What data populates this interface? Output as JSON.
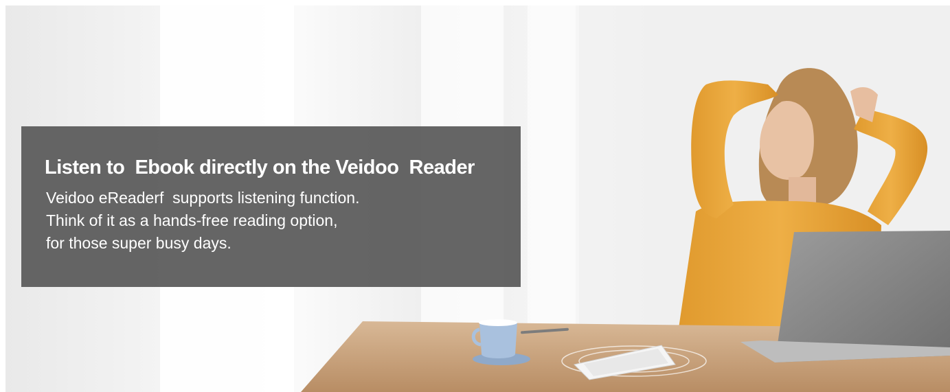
{
  "banner": {
    "headline": "Listen to  Ebook directly on the Veidoo  Reader",
    "lines": [
      "Veidoo eReaderf  supports listening function.",
      "Think of it as a hands-free reading option,",
      "for those super busy days."
    ]
  },
  "colors": {
    "overlay": "#585858",
    "text": "#ffffff",
    "shirt": "#e8a23a",
    "desk": "#c9a27a"
  }
}
